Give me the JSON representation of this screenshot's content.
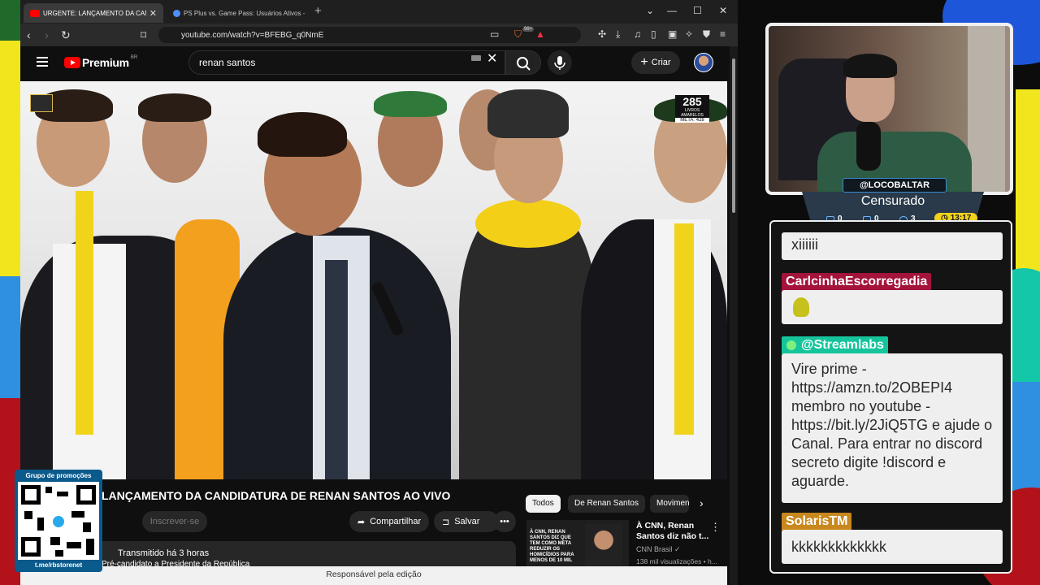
{
  "browser": {
    "tabs": [
      {
        "title": "URGENTE: LANÇAMENTO DA CAND",
        "active": true
      },
      {
        "title": "PS Plus vs. Game Pass: Usuários Ativos - Goo",
        "active": false
      }
    ],
    "url": "youtube.com/watch?v=BFEBG_q0NmE",
    "ext_badge": "99+"
  },
  "youtube": {
    "logo_text": "Premium",
    "region": "BR",
    "search_value": "renan santos",
    "create_label": "Criar"
  },
  "video": {
    "counter_big": "285",
    "counter_small": "LIVROS AMARELOS",
    "counter_goal": "META: 428",
    "title": "LANÇAMENTO DA CANDIDATURA DE RENAN SANTOS AO VIVO",
    "subscribe_label": "Inscrever-se",
    "share_label": "Compartilhar",
    "save_label": "Salvar",
    "description_meta": "Transmitido há 3 horas",
    "description_text": "Pré-candidato a Presidente da República",
    "footer": "Responsável pela edição"
  },
  "chips": [
    "Todos",
    "De Renan Santos",
    "Movimentos"
  ],
  "recommendation": {
    "thumb_text": "À CNN, RENAN SANTOS DIZ QUE TEM COMO META REDUZIR OS HOMICÍDIOS PARA MENOS DE 10 MIL",
    "title": "À CNN, Renan Santos diz não t...",
    "channel": "CNN Brasil",
    "meta": "138 mil visualizações • h..."
  },
  "qr": {
    "title": "Grupo de promoções",
    "link": "t.me/rbstorenet"
  },
  "streamer": {
    "handle": "@LOCOBALTAR",
    "status": "Censurado",
    "stats": [
      "0",
      "0",
      "3"
    ],
    "timer": "13:17"
  },
  "chat": {
    "messages": [
      {
        "user": "",
        "text": "xiiiiii"
      },
      {
        "user": "CarlcinhaEscorregadia",
        "text": ""
      },
      {
        "user": "@Streamlabs",
        "text": "Vire prime - https://amzn.to/2OBEPI4 membro no youtube - https://bit.ly/2JiQ5TG e ajude o Canal. Para entrar no discord secreto digite !discord e aguarde."
      },
      {
        "user": "SolarisTM",
        "text": "kkkkkkkkkkkkk"
      }
    ]
  },
  "colors": {
    "yt_red": "#ff0000",
    "chat_name_1": "#a3133a",
    "chat_name_streamlabs": "#16c49c",
    "chat_name_solaris": "#c8881d",
    "timer_badge": "#f2d21a"
  }
}
